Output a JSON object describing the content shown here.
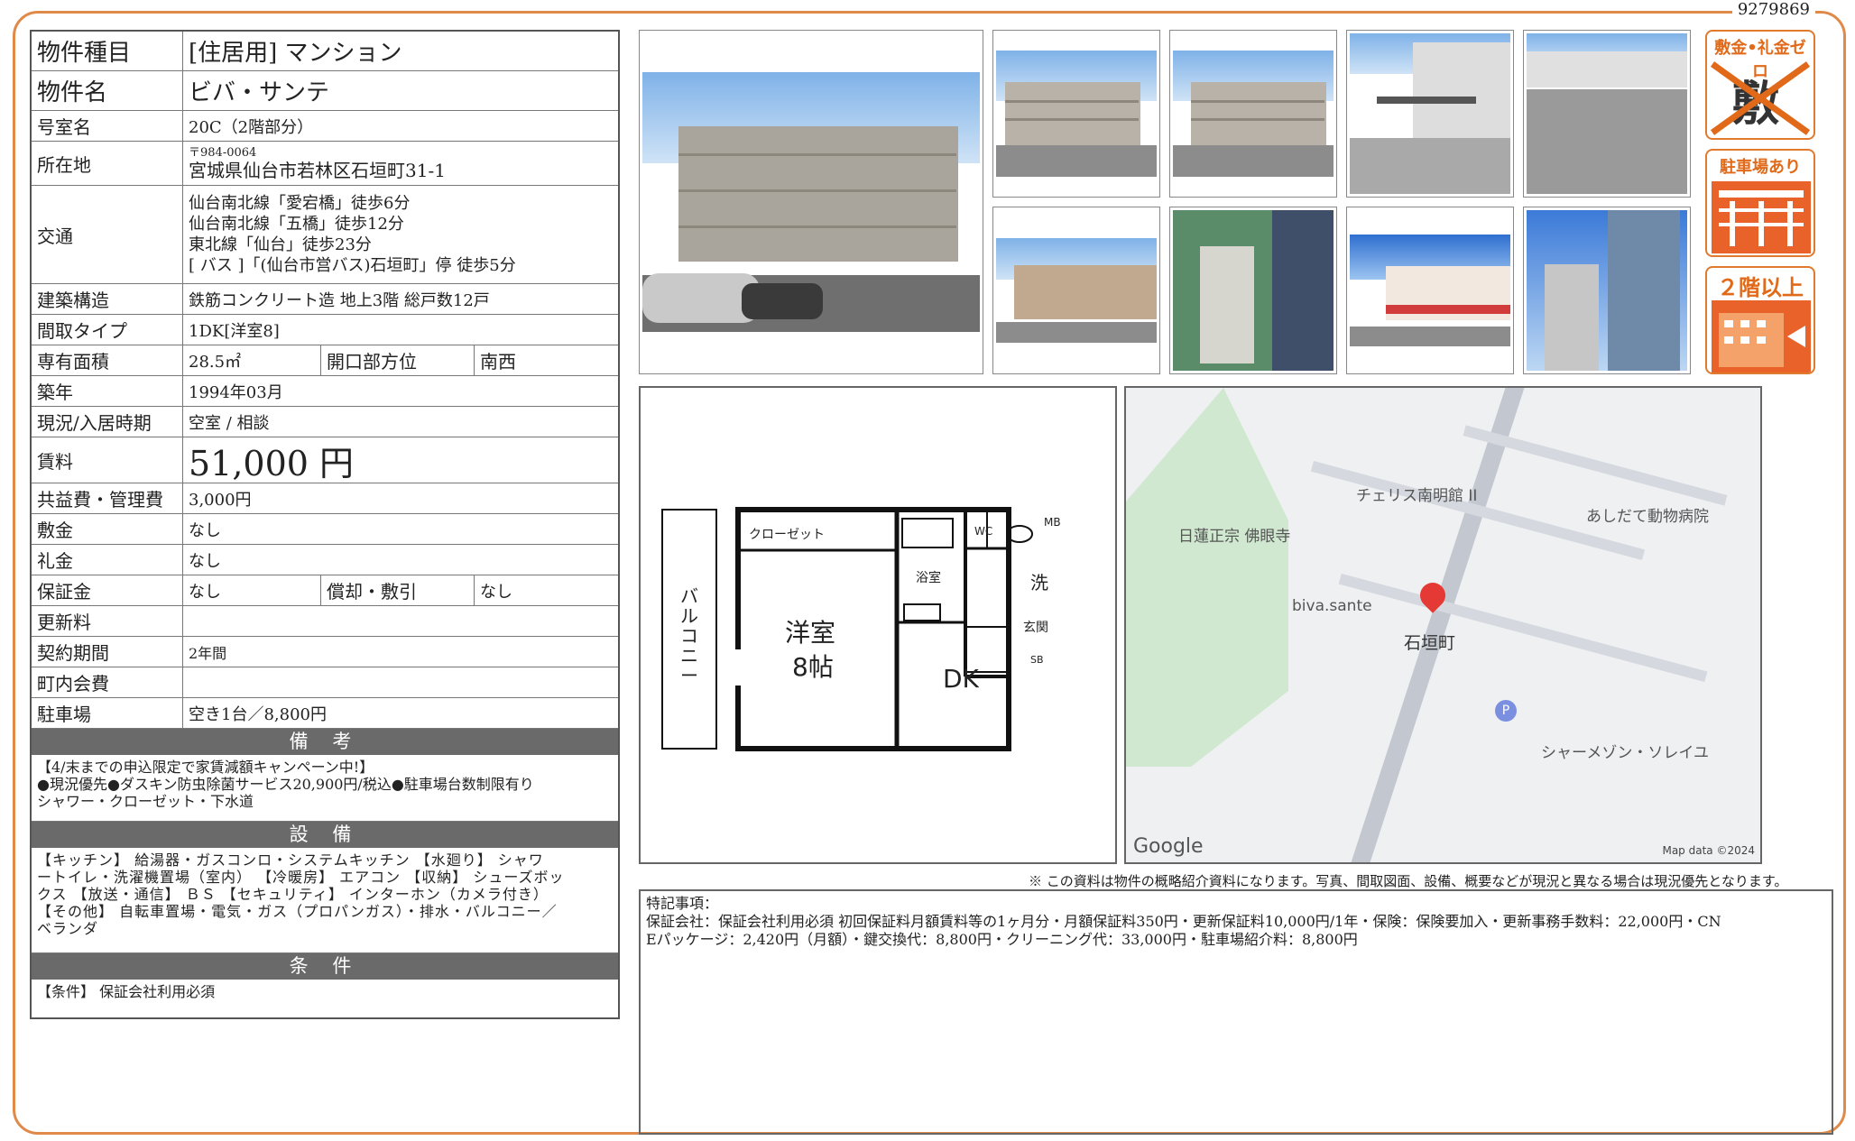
{
  "doc_id": "9279869",
  "info": {
    "type_label": "物件種目",
    "type_value": "[住居用] マンション",
    "name_label": "物件名",
    "name_value": "ビバ・サンテ",
    "room_label": "号室名",
    "room_value": "20C（2階部分）",
    "address_label": "所在地",
    "postal": "〒984-0064",
    "address": "宮城県仙台市若林区石垣町31-1",
    "access_label": "交通",
    "access": [
      "仙台南北線「愛宕橋」徒歩6分",
      "仙台南北線「五橋」徒歩12分",
      "東北線「仙台」徒歩23分",
      "[ バス ]「(仙台市営バス)石垣町」停 徒歩5分"
    ],
    "structure_label": "建築構造",
    "structure_value": "鉄筋コンクリート造 地上3階 総戸数12戸",
    "layout_label": "間取タイプ",
    "layout_value": "1DK[洋室8]",
    "area_label": "専有面積",
    "area_value": "28.5㎡",
    "direction_label": "開口部方位",
    "direction_value": "南西",
    "built_label": "築年",
    "built_value": "1994年03月",
    "status_label": "現況/入居時期",
    "status_value": "空室 / 相談",
    "rent_label": "賃料",
    "rent_value": "51,000 円",
    "fee_label": "共益費・管理費",
    "fee_value": "3,000円",
    "deposit_label": "敷金",
    "deposit_value": "なし",
    "key_label": "礼金",
    "key_value": "なし",
    "guarantee_label": "保証金",
    "guarantee_value": "なし",
    "amort_label": "償却・敷引",
    "amort_value": "なし",
    "renewal_label": "更新料",
    "renewal_value": "",
    "contract_label": "契約期間",
    "contract_value": "2年間",
    "town_label": "町内会費",
    "town_value": "",
    "parking_label": "駐車場",
    "parking_value": "空き1台／8,800円"
  },
  "remarks": {
    "heading": "備 考",
    "lines": [
      "【4/末までの申込限定で家賃減額キャンペーン中!】",
      "●現況優先●ダスキン防虫除菌サービス20,900円/税込●駐車場台数制限有り",
      "シャワー・クローゼット・下水道"
    ]
  },
  "equipment": {
    "heading": "設 備",
    "lines": [
      "【キッチン】 給湯器・ガスコンロ・システムキッチン 【水廻り】 シャワ",
      "ートイレ・洗濯機置場（室内） 【冷暖房】 エアコン 【収納】 シューズボッ",
      "クス 【放送・通信】 ＢＳ 【セキュリティ】 インターホン（カメラ付き）",
      "【その他】 自転車置場・電気・ガス（プロパンガス）・排水・バルコニー／",
      "ベランダ"
    ]
  },
  "conditions": {
    "heading": "条 件",
    "lines": [
      "【条件】 保証会社利用必須"
    ]
  },
  "badges": {
    "b1": "敷金•礼金ゼロ",
    "b1_chars": "敷礼",
    "b2": "駐車場あり",
    "b3": "２階以上"
  },
  "floorplan": {
    "closet": "クローゼット",
    "balcony": "バルコニー",
    "western_room": "洋室",
    "tatami": "8帖",
    "bath": "浴室",
    "wc": "WC",
    "mb": "MB",
    "wash": "洗",
    "entrance": "玄関",
    "sb": "SB",
    "dk": "DK"
  },
  "map": {
    "labels": [
      "チェリス南明館 II",
      "あしだて動物病院",
      "日蓮正宗 佛眼寺",
      "biva.sante",
      "石垣町",
      "シャーメゾン・ソレイユ"
    ],
    "google": "Google",
    "map_data": "Map data ©2024",
    "parking_symbol": "P"
  },
  "disclaimer": "※ この資料は物件の概略紹介資料になります。写真、間取図面、設備、概要などが現況と異なる場合は現況優先となります。",
  "special_notes": {
    "title": "特記事項：",
    "text": "保証会社：保証会社利用必須 初回保証料月額賃料等の1ヶ月分・月額保証料350円・更新保証料10,000円/1年・保険：保険要加入・更新事務手数料：22,000円・CN",
    "text2": "Eパッケージ：2,420円（月額）・鍵交換代：8,800円・クリーニング代：33,000円・駐車場紹介料：8,800円"
  }
}
